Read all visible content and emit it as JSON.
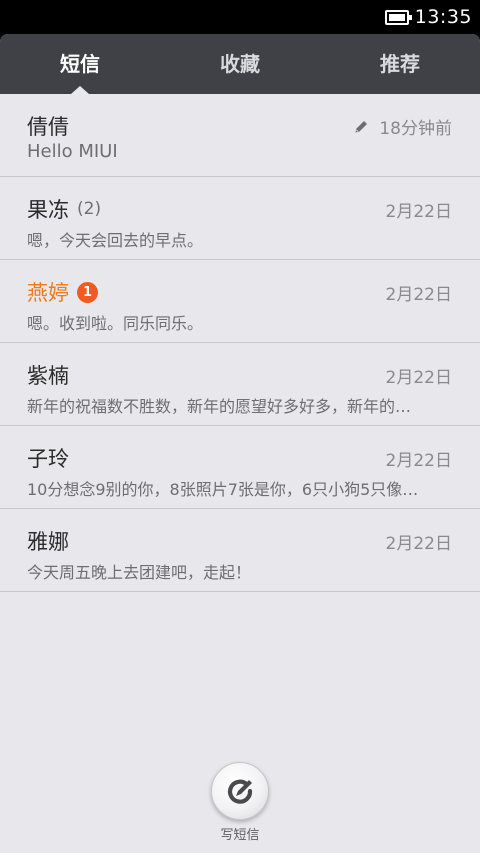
{
  "status_bar": {
    "time": "13:35",
    "battery_level": 1.0
  },
  "tabs": [
    {
      "label": "短信",
      "active": true
    },
    {
      "label": "收藏",
      "active": false
    },
    {
      "label": "推荐",
      "active": false
    }
  ],
  "conversations": [
    {
      "name": "倩倩",
      "count": "",
      "badge": "",
      "time": "18分钟前",
      "snippet": "Hello MIUI",
      "draft": true,
      "unread": false
    },
    {
      "name": "果冻",
      "count": "(2)",
      "badge": "",
      "time": "2月22日",
      "snippet": "嗯，今天会回去的早点。",
      "draft": false,
      "unread": false
    },
    {
      "name": "燕婷",
      "count": "",
      "badge": "1",
      "time": "2月22日",
      "snippet": "嗯。收到啦。同乐同乐。",
      "draft": false,
      "unread": true
    },
    {
      "name": "紫楠",
      "count": "",
      "badge": "",
      "time": "2月22日",
      "snippet": "新年的祝福数不胜数，新年的愿望好多好多，新年的…",
      "draft": false,
      "unread": false
    },
    {
      "name": "子玲",
      "count": "",
      "badge": "",
      "time": "2月22日",
      "snippet": "10分想念9别的你，8张照片7张是你，6只小狗5只像…",
      "draft": false,
      "unread": false
    },
    {
      "name": "雅娜",
      "count": "",
      "badge": "",
      "time": "2月22日",
      "snippet": "今天周五晚上去团建吧，走起！",
      "draft": false,
      "unread": false
    }
  ],
  "compose": {
    "label": "写短信"
  },
  "colors": {
    "accent": "#f07a18",
    "badge": "#f15a22",
    "tab_bar": "#3f4147",
    "background": "#e8e8ec"
  }
}
